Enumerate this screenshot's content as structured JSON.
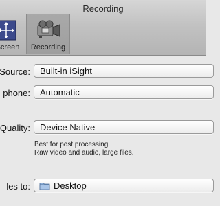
{
  "window": {
    "title": "Recording"
  },
  "toolbar": {
    "items": [
      {
        "label": "Screen",
        "icon": "screen-icon",
        "selected": false
      },
      {
        "label": "Recording",
        "icon": "camera-icon",
        "selected": true
      }
    ]
  },
  "form": {
    "source": {
      "label": "Source:",
      "value": "Built-in iSight"
    },
    "microphone": {
      "label": "phone:",
      "value": "Automatic"
    },
    "quality": {
      "label": "Quality:",
      "value": "Device Native",
      "hint_line1": "Best for post processing.",
      "hint_line2": "Raw video and audio, large files."
    },
    "save_to": {
      "label": "les to:",
      "value": "Desktop",
      "icon": "folder-icon"
    }
  },
  "colors": {
    "toolbar_bg": "#c2c2c2",
    "selected_tab": "#a3a3a3",
    "window_bg": "#e8e8e8"
  }
}
